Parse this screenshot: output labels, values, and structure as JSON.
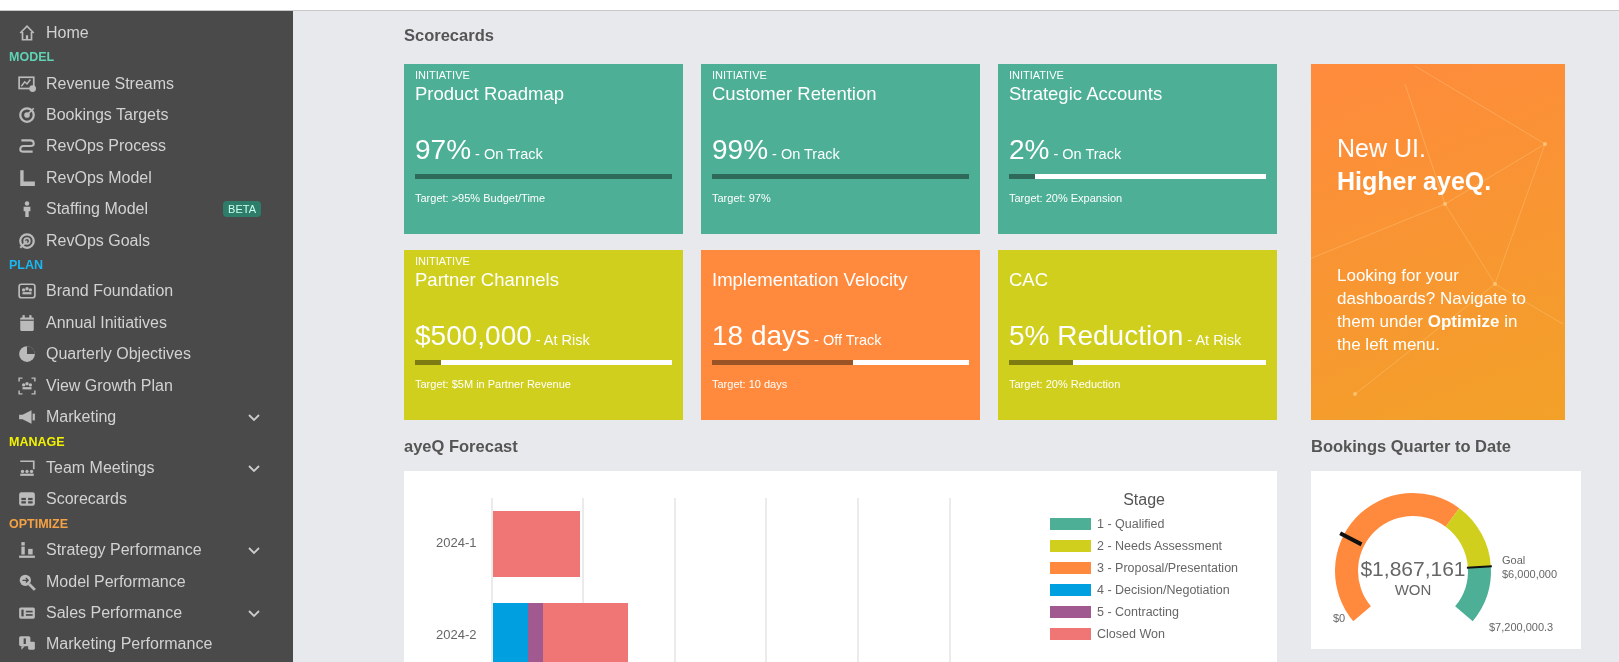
{
  "sidebar": {
    "home": {
      "label": "Home"
    },
    "sections": [
      {
        "heading": "MODEL",
        "color": "#5fd3b4",
        "items": [
          {
            "label": "Revenue Streams"
          },
          {
            "label": "Bookings Targets"
          },
          {
            "label": "RevOps Process"
          },
          {
            "label": "RevOps Model"
          },
          {
            "label": "Staffing Model",
            "badge": "BETA"
          },
          {
            "label": "RevOps Goals"
          }
        ]
      },
      {
        "heading": "PLAN",
        "color": "#1ab8f0",
        "items": [
          {
            "label": "Brand Foundation"
          },
          {
            "label": "Annual Initiatives"
          },
          {
            "label": "Quarterly Objectives"
          },
          {
            "label": "View Growth Plan"
          },
          {
            "label": "Marketing",
            "expanded": false
          }
        ]
      },
      {
        "heading": "MANAGE",
        "color": "#f2f200",
        "items": [
          {
            "label": "Team Meetings",
            "expanded": false
          },
          {
            "label": "Scorecards"
          }
        ]
      },
      {
        "heading": "OPTIMIZE",
        "color": "#f4a245",
        "items": [
          {
            "label": "Strategy Performance",
            "expanded": false
          },
          {
            "label": "Model Performance"
          },
          {
            "label": "Sales Performance",
            "expanded": false
          },
          {
            "label": "Marketing Performance"
          }
        ]
      }
    ]
  },
  "scorecards": {
    "title": "Scorecards",
    "cards": [
      {
        "label": "INITIATIVE",
        "title": "Product Roadmap",
        "value": "97%",
        "status": "- On Track",
        "level": 1.0,
        "target": "Target: >95% Budget/Time",
        "color": "#4caf96"
      },
      {
        "label": "INITIATIVE",
        "title": "Customer Retention",
        "value": "99%",
        "status": "- On Track",
        "level": 1.0,
        "target": "Target: 97%",
        "color": "#4caf96"
      },
      {
        "label": "INITIATIVE",
        "title": "Strategic Accounts",
        "value": "2%",
        "status": "- On Track",
        "level": 0.1,
        "target": "Target: 20% Expansion",
        "color": "#4caf96"
      },
      {
        "label": "INITIATIVE",
        "title": "Partner Channels",
        "value": "$500,000",
        "status": "- At Risk",
        "level": 0.1,
        "target": "Target: $5M in Partner Revenue",
        "color": "#d0cf1e"
      },
      {
        "title": "Implementation Velocity",
        "value": "18 days",
        "status": "- Off Track",
        "level": 0.55,
        "target": "Target: 10 days",
        "color": "#ff8a3d"
      },
      {
        "title": "CAC",
        "value": "5% Reduction",
        "status": "- At Risk",
        "level": 0.25,
        "target": "Target: 20% Reduction",
        "color": "#d0cf1e"
      }
    ]
  },
  "promo": {
    "line_1": "New UI.",
    "line_2": "Higher ayeQ.",
    "text": "Looking for your dashboards? Navigate to them under **Optimize** in the left menu."
  },
  "forecast": {
    "title": "ayeQ Forecast",
    "row_labels": [
      "2024-1",
      "2024-2"
    ],
    "legend_title": "Stage",
    "legend": [
      {
        "label": "1 - Qualified",
        "color": "#4caf96"
      },
      {
        "label": "2 - Needs Assessment",
        "color": "#d0cf1e"
      },
      {
        "label": "3 - Proposal/Presentation",
        "color": "#ff8a3d"
      },
      {
        "label": "4 - Decision/Negotiation",
        "color": "#00a0e0"
      },
      {
        "label": "5 - Contracting",
        "color": "#a05a90"
      },
      {
        "label": "Closed Won",
        "color": "#f07575"
      }
    ]
  },
  "bookings": {
    "title": "Bookings Quarter to Date",
    "value": "$1,867,161",
    "caption": "WON",
    "goal_label": "Goal",
    "goal_value": "$6,000,000",
    "min": "$0",
    "max": "$7,200,000.3"
  }
}
